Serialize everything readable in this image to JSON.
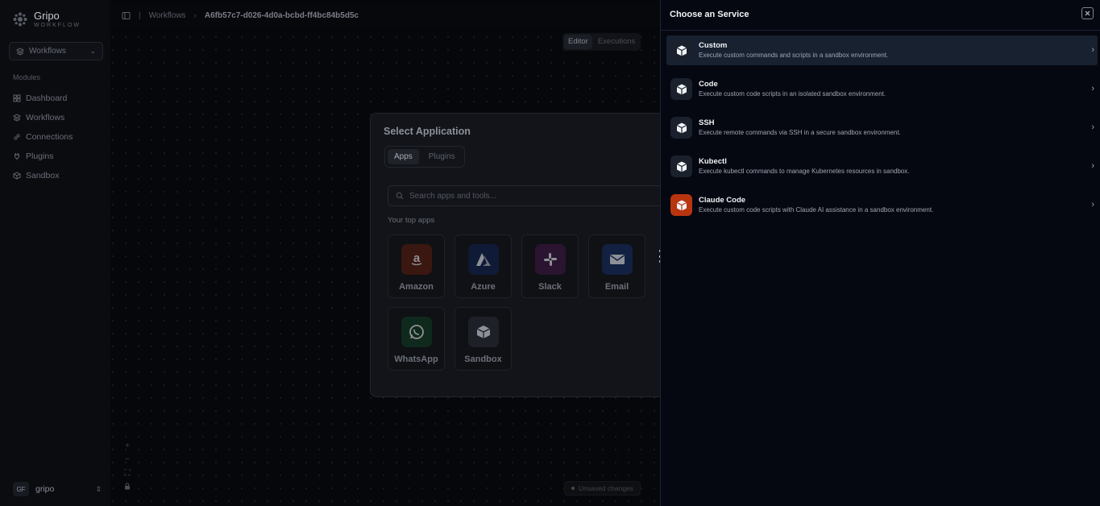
{
  "sidebar": {
    "brand": "Gripo",
    "brand_sub": "WORKFLOW",
    "workspace": "Workflows",
    "modules_label": "Modules",
    "items": [
      {
        "label": "Dashboard",
        "icon": "dashboard-icon"
      },
      {
        "label": "Workflows",
        "icon": "layers-icon"
      },
      {
        "label": "Connections",
        "icon": "link-icon"
      },
      {
        "label": "Plugins",
        "icon": "plug-icon"
      },
      {
        "label": "Sandbox",
        "icon": "box-icon"
      }
    ],
    "user": {
      "initials": "GF",
      "name": "gripo"
    }
  },
  "canvas": {
    "breadcrumb": {
      "parent": "Workflows",
      "current": "A6fb57c7-d026-4d0a-bcbd-ff4bc84b5d5c"
    },
    "modes": {
      "editor": "Editor",
      "executions": "Executions"
    },
    "zoom": {
      "in": "+",
      "out": "−",
      "fit": "⛶",
      "lock": "🔒"
    },
    "status": "Unsaved changes"
  },
  "app_modal": {
    "title": "Select Application",
    "tabs": [
      "Apps",
      "Plugins"
    ],
    "search_placeholder": "Search apps and tools...",
    "top_apps_label": "Your top apps",
    "apps": [
      {
        "name": "Amazon",
        "color": "#3a1710"
      },
      {
        "name": "Azure",
        "color": "#0f1a36"
      },
      {
        "name": "Slack",
        "color": "#2a1430"
      },
      {
        "name": "Email",
        "color": "#122141"
      },
      {
        "name": "WhatsApp",
        "color": "#0f2a1c"
      },
      {
        "name": "Sandbox",
        "color": "#1d2027"
      }
    ]
  },
  "service_panel": {
    "title": "Choose an Service",
    "services": [
      {
        "name": "Custom",
        "desc": "Execute custom commands and scripts in a sandbox environment."
      },
      {
        "name": "Code",
        "desc": "Execute custom code scripts in an isolated sandbox environment."
      },
      {
        "name": "SSH",
        "desc": "Execute remote commands via SSH in a secure sandbox environment."
      },
      {
        "name": "Kubectl",
        "desc": "Execute kubectl commands to manage Kubernetes resources in sandbox."
      },
      {
        "name": "Claude Code",
        "desc": "Execute custom code scripts with Claude AI assistance in a sandbox environment."
      }
    ]
  }
}
